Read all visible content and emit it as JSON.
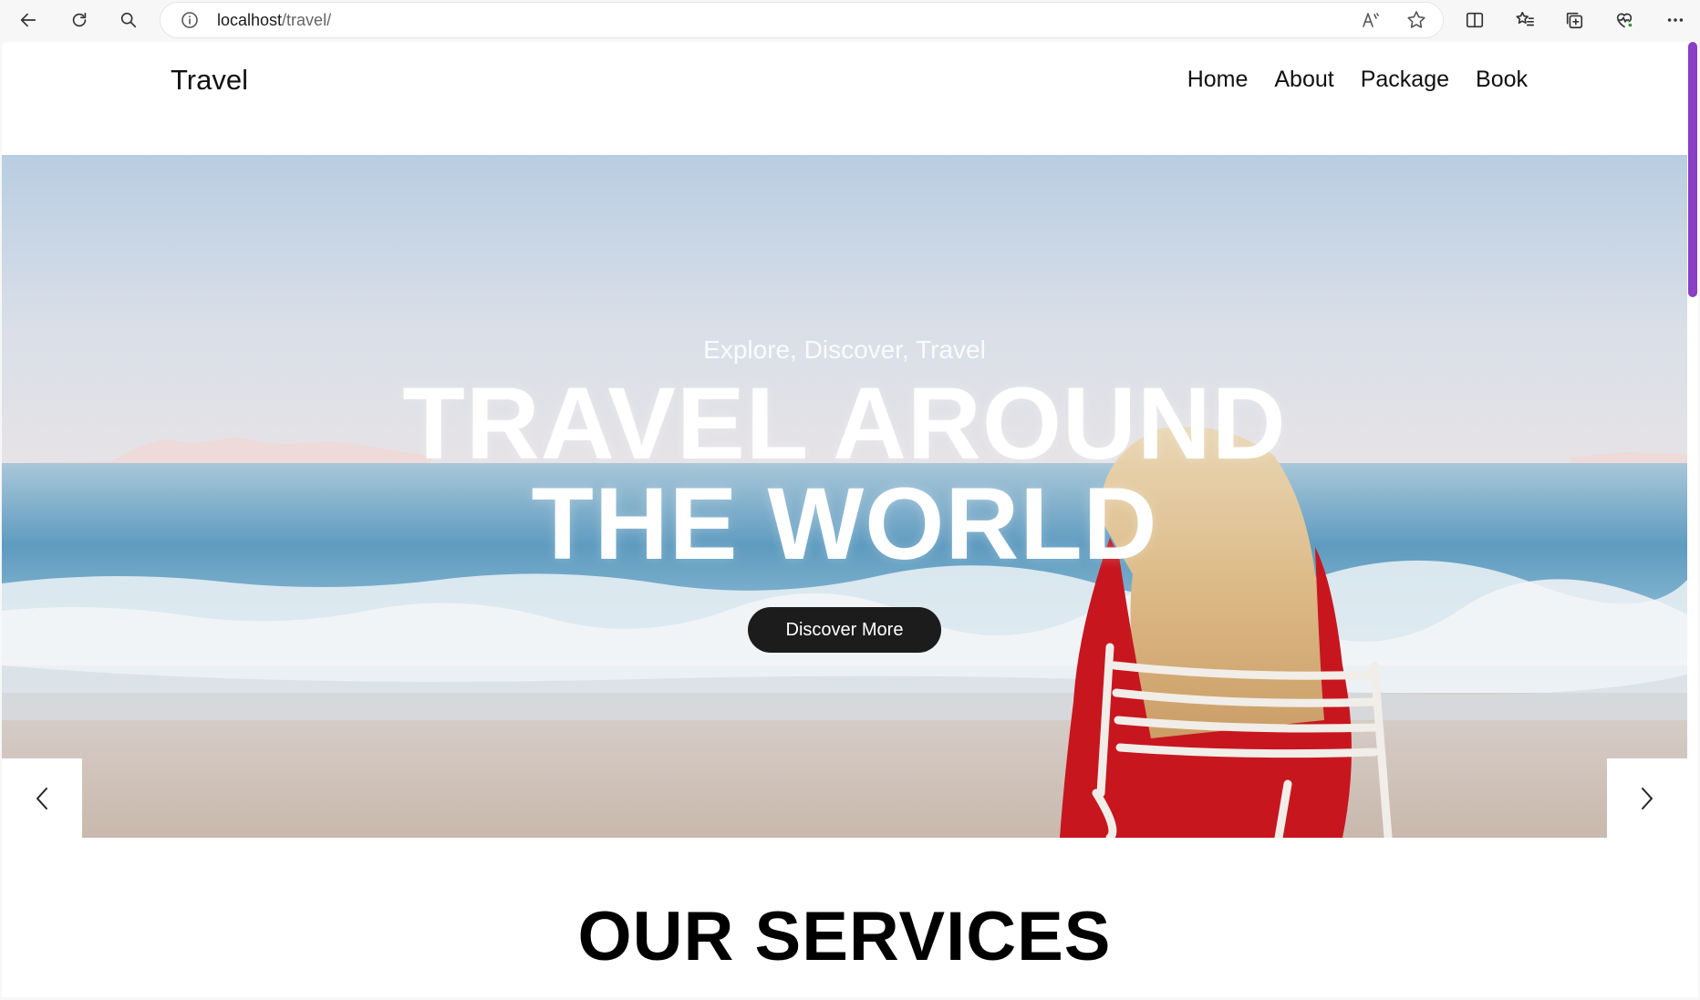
{
  "browser": {
    "url_host": "localhost",
    "url_path": "/travel/",
    "icons": [
      "back-icon",
      "reload-icon",
      "search-icon",
      "info-icon",
      "read-aloud-icon",
      "favorite-star-icon",
      "split-screen-icon",
      "favorites-icon",
      "collections-icon",
      "browser-essentials-icon",
      "more-icon"
    ]
  },
  "nav": {
    "brand": "Travel",
    "links": [
      "Home",
      "About",
      "Package",
      "Book"
    ]
  },
  "hero": {
    "tagline": "Explore, Discover, Travel",
    "headline_line1": "TRAVEL AROUND",
    "headline_line2": "THE WORLD",
    "cta_label": "Discover More",
    "prev_icon": "chevron-left-icon",
    "next_icon": "chevron-right-icon"
  },
  "services": {
    "title": "OUR SERVICES"
  },
  "colors": {
    "scrollbar": "#8a3fc4",
    "cta_bg": "#1c1c1c"
  }
}
